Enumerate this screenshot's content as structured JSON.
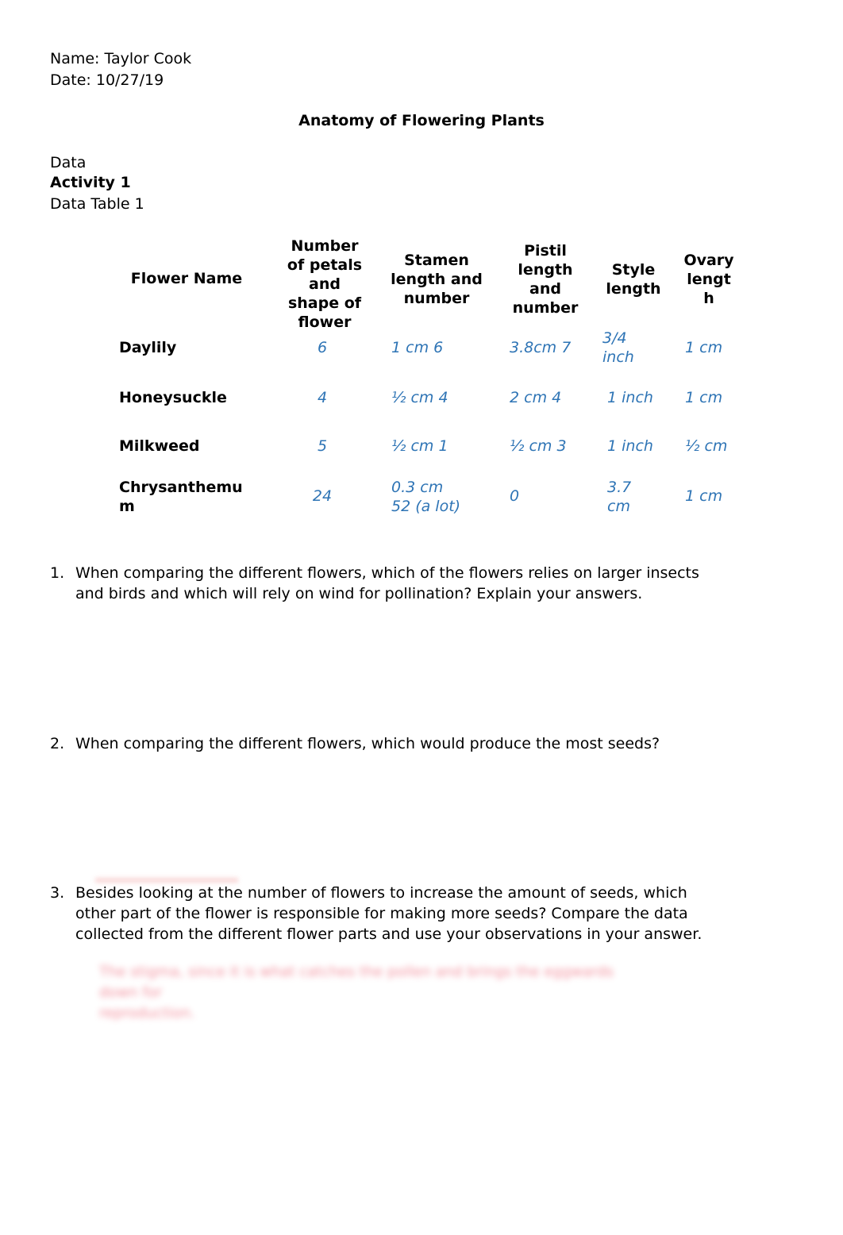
{
  "header": {
    "name_line": "Name: Taylor Cook",
    "date_line": "Date: 10/27/19",
    "title": "Anatomy of Flowering Plants"
  },
  "section": {
    "data_label": "Data",
    "activity_label": "Activity 1",
    "table_label": "Data Table 1"
  },
  "table": {
    "headers": [
      "Flower Name",
      "Number of petals and shape of flower",
      "Stamen length and number",
      "Pistil length and number",
      "Style length",
      "Ovary length"
    ],
    "header_lines": {
      "flower_name": [
        "Flower Name"
      ],
      "petals": [
        "Number",
        "of petals",
        "and",
        "shape of",
        "flower"
      ],
      "stamen": [
        "Stamen",
        "length and",
        "number"
      ],
      "pistil": [
        "Pistil",
        "length",
        "and",
        "number"
      ],
      "style": [
        "Style",
        "length"
      ],
      "ovary": [
        "Ovary",
        "lengt",
        "h"
      ]
    },
    "rows": [
      {
        "name": "Daylily",
        "petals": "6",
        "stamen": "1 cm 6",
        "pistil": "3.8cm 7",
        "style": "3/4 inch",
        "ovary": "1 cm"
      },
      {
        "name": "Honeysuckle",
        "petals": "4",
        "stamen": "½ cm 4",
        "pistil": "2 cm 4",
        "style": "1 inch",
        "ovary": "1 cm"
      },
      {
        "name": "Milkweed",
        "petals": "5",
        "stamen": "½ cm 1",
        "pistil": "½ cm 3",
        "style": "1 inch",
        "ovary": "½ cm"
      },
      {
        "name": "Chrysanthemum",
        "petals": "24",
        "stamen": "0.3 cm 52 (a lot)",
        "pistil": "0",
        "style": "3.7 cm",
        "ovary": "1 cm"
      }
    ],
    "row_name_lines": {
      "chrysanthemum": [
        "Chrysanthemu",
        "m"
      ]
    },
    "cell_lines": {
      "daylily_style": [
        "3/4",
        "inch"
      ],
      "chrys_stamen": [
        "0.3 cm",
        "52 (a lot)"
      ],
      "chrys_style": [
        "3.7",
        "cm"
      ]
    }
  },
  "questions": [
    {
      "number": "1.",
      "lines": [
        "When comparing the different flowers, which of the flowers relies on larger insects",
        "and birds and which will rely on wind for pollination? Explain your answers."
      ]
    },
    {
      "number": "2.",
      "lines": [
        "When comparing the different flowers, which would produce the most seeds?"
      ]
    },
    {
      "number": "3.",
      "lines": [
        "Besides looking at the number of flowers to increase the amount of seeds, which",
        "other part of the flower is responsible for making more seeds? Compare the data",
        "collected from the different flower parts and use your observations in your answer."
      ]
    }
  ],
  "blurred_answer": {
    "lines": [
      "The stigma, since it is what catches the pollen and brings the eggwards down for",
      "reproduction."
    ]
  },
  "colors": {
    "answer_blue": "#2E74B5",
    "blurred_red": "#e8384f"
  }
}
